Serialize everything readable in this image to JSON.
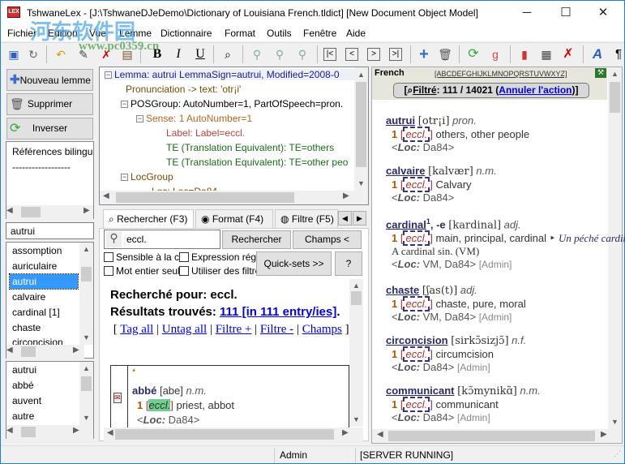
{
  "window": {
    "title": "TshwaneLex - [J:\\TshwaneDJeDemo\\Dictionary of Louisiana French.tldict] [New Document Object Model]",
    "app_icon": "LEX",
    "minimize": "─",
    "maximize": "☐",
    "close": "✕"
  },
  "watermark": {
    "line1": "河东软件园",
    "line2": "www.pc0359.cn"
  },
  "menu": [
    "Fichier",
    "Edition",
    "Vue",
    "Lemme",
    "Dictionnaire",
    "Format",
    "Outils",
    "Fenêtre",
    "Aide"
  ],
  "toolbar": {
    "bold": "B",
    "italic": "I",
    "underline": "U",
    "first": "|<",
    "prev": "<",
    "next": ">",
    "last": ">|",
    "add": "+",
    "pilcrow": "¶",
    "font": "A"
  },
  "left": {
    "new_lemma": "Nouveau lemme",
    "delete": "Supprimer",
    "invert": "Inverser",
    "references": [
      "Références bilingues",
      "------------------"
    ],
    "search_value": "autrui",
    "lemma_list": [
      "assomption",
      "auriculaire",
      "autrui",
      "calvaire",
      "cardinal [1]",
      "chaste",
      "circoncision"
    ],
    "selected_index": 2,
    "second_list": [
      "autrui",
      "abbé",
      "auvent",
      "autre"
    ]
  },
  "tree": {
    "nodes": [
      {
        "text": "Lemma: autrui  LemmaSign=autrui, Modified=2008-0",
        "color": "#1a1a8c"
      },
      {
        "text": "Pronunciation -> text: 'otr¡i'",
        "color": "#7a4a00"
      },
      {
        "text": "POSGroup:  AutoNumber=1, PartOfSpeech=pron.",
        "color": "#000"
      },
      {
        "text": "Sense: 1  AutoNumber=1",
        "color": "#b8661a"
      },
      {
        "text": "Label:  Label=eccl.",
        "color": "#c04040"
      },
      {
        "text": "TE (Translation Equivalent):  TE=others",
        "color": "#1a6a1a"
      },
      {
        "text": "TE (Translation Equivalent):  TE=other peo",
        "color": "#1a6a1a"
      },
      {
        "text": "LocGroup",
        "color": "#7a4a00"
      },
      {
        "text": "Loc: Loc=Da84",
        "color": "#7a4a00"
      }
    ]
  },
  "search": {
    "tabs": [
      "Rechercher (F3)",
      "Format (F4)",
      "Filtre (F5)"
    ],
    "query": "eccl.",
    "search_button": "Rechercher",
    "fields_button": "Champs <",
    "quicksets_button": "Quick-sets >>",
    "help_button": "?",
    "options": [
      "Sensible à la casse",
      "Expression régulière",
      "Mot entier seulement",
      "Utiliser des filtres"
    ],
    "searched_for": "Recherché pour: eccl.",
    "results_label": "Résultats trouvés: ",
    "results_link": "111 [in 111 entry/ies]",
    "actions": [
      "Tag all",
      "Untag all",
      "Filtre +",
      "Filtre -",
      "Champs"
    ],
    "result_entry": {
      "marker": "*",
      "headword": "abbé",
      "pron": "[abe]",
      "pos": "n.m.",
      "sense": "1",
      "label": "eccl.",
      "gloss": "priest, abbot",
      "loc_label": "Loc:",
      "loc": "Da84"
    }
  },
  "preview": {
    "language": "French",
    "alphabet": "[ABCDEFGHIJKLMNOPQRSTUVWXYZ]",
    "filter_label": "Filtré",
    "filter_count": ": 111 / 14021 (",
    "undo": "Annuler l'action",
    "entries": [
      {
        "headword": "autrui",
        "sup": "",
        "suffix": "",
        "pron": "[otr¡i]",
        "pos": "pron.",
        "sense": "1",
        "label": "eccl.",
        "gloss": "others, other people",
        "example": "",
        "translation": "",
        "loc": "Da84",
        "admin": ""
      },
      {
        "headword": "calvaire",
        "sup": "",
        "suffix": "",
        "pron": "[kalvær]",
        "pos": "n.m.",
        "sense": "1",
        "label": "eccl.",
        "gloss": "Calvary",
        "example": "",
        "translation": "",
        "loc": "Da84",
        "admin": ""
      },
      {
        "headword": "cardinal",
        "sup": "1",
        "suffix": ", -e",
        "pron": "[kardinal]",
        "pos": "adj.",
        "sense": "1",
        "label": "eccl.",
        "gloss": "main, principal, cardinal ‣",
        "example": "Un péché cardinal.",
        "translation": "A cardinal sin. (VM)",
        "loc": "VM, Da84",
        "admin": "[Admin]"
      },
      {
        "headword": "chaste",
        "sup": "",
        "suffix": "",
        "pron": "[ʃas(t)]",
        "pos": "adj.",
        "sense": "1",
        "label": "eccl.",
        "gloss": "chaste, pure, moral",
        "example": "",
        "translation": "",
        "loc": "VM, Da84",
        "admin": "[Admin]"
      },
      {
        "headword": "circoncision",
        "sup": "",
        "suffix": "",
        "pron": "[sirkɔ̃sizjɔ̃]",
        "pos": "n.f.",
        "sense": "1",
        "label": "eccl.",
        "gloss": "circumcision",
        "example": "",
        "translation": "",
        "loc": "Da84",
        "admin": "[Admin]"
      },
      {
        "headword": "communicant",
        "sup": "",
        "suffix": "",
        "pron": "[kɔ̃mynikɑ̃]",
        "pos": "n.m.",
        "sense": "1",
        "label": "eccl.",
        "gloss": "communicant",
        "example": "",
        "translation": "",
        "loc": "Da84",
        "admin": "[Admin]"
      }
    ],
    "loc_label": "Loc:"
  },
  "status": {
    "user": "Admin",
    "server": "[SERVER RUNNING]"
  }
}
